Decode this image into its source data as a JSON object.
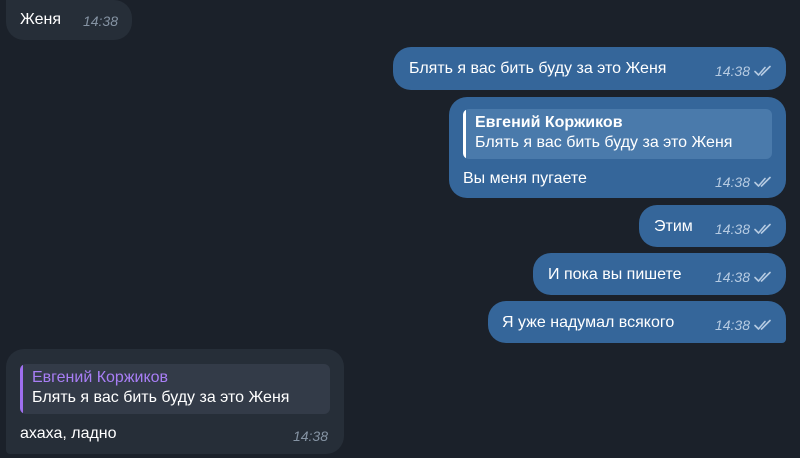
{
  "messages": [
    {
      "text": "Женя",
      "time": "14:38"
    },
    {
      "text": "Блять я вас бить буду за это Женя",
      "time": "14:38"
    },
    {
      "reply_name": "Евгений Коржиков",
      "reply_text": "Блять я вас бить буду за это Женя",
      "text": "Вы меня пугаете",
      "time": "14:38"
    },
    {
      "text": "Этим",
      "time": "14:38"
    },
    {
      "text": "И пока вы пишете",
      "time": "14:38"
    },
    {
      "text": "Я уже надумал всякого",
      "time": "14:38"
    },
    {
      "reply_name": "Евгений Коржиков",
      "reply_text": "Блять я вас бить буду за это Женя",
      "text": "ахаха, ладно",
      "time": "14:38"
    }
  ],
  "colors": {
    "background": "#1b212a",
    "incoming": "#262e38",
    "outgoing": "#35669a",
    "reply_accent": "#a87ef5"
  },
  "icons": {
    "read_receipt": "double-check-icon"
  }
}
